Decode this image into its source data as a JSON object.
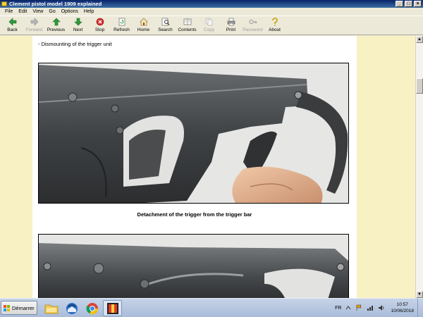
{
  "window": {
    "title": "Clement pistol model 1909 explained"
  },
  "menu": [
    "File",
    "Edit",
    "View",
    "Go",
    "Options",
    "Help"
  ],
  "toolbar": [
    {
      "label": "Back",
      "icon": "back-arrow-icon",
      "enabled": true
    },
    {
      "label": "Forward",
      "icon": "forward-arrow-icon",
      "enabled": false
    },
    {
      "label": "Previous",
      "icon": "previous-arrow-icon",
      "enabled": true
    },
    {
      "label": "Next",
      "icon": "next-arrow-icon",
      "enabled": true
    },
    {
      "label": "Stop",
      "icon": "stop-icon",
      "enabled": true
    },
    {
      "label": "Refresh",
      "icon": "refresh-icon",
      "enabled": true
    },
    {
      "label": "Home",
      "icon": "home-icon",
      "enabled": true
    },
    {
      "label": "Search",
      "icon": "search-icon",
      "enabled": true
    },
    {
      "label": "Contents",
      "icon": "contents-icon",
      "enabled": true
    },
    {
      "label": "Copy",
      "icon": "copy-icon",
      "enabled": false
    },
    {
      "label": "Print",
      "icon": "print-icon",
      "enabled": true
    },
    {
      "label": "Password",
      "icon": "key-icon",
      "enabled": false
    },
    {
      "label": "About",
      "icon": "about-icon",
      "enabled": true
    }
  ],
  "page": {
    "heading": "- Dismounting of the trigger unit",
    "caption": "Detachment of the trigger from the trigger bar"
  },
  "taskbar": {
    "start_label": "Démarrer",
    "language": "FR",
    "time": "10:57",
    "date": "10/06/2018"
  },
  "colors": {
    "page_margin": "#f8f1c4",
    "content_bg": "#ffffff",
    "titlebar": "#0a246a"
  }
}
